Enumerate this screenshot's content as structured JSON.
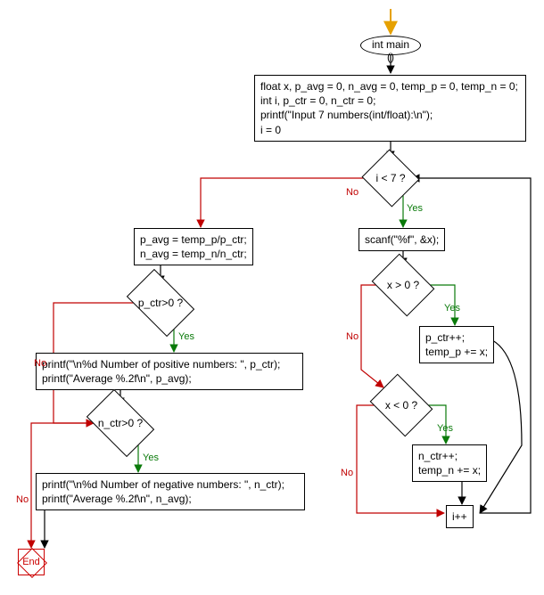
{
  "chart_data": {
    "type": "flowchart",
    "nodes": [
      {
        "id": "start",
        "label": "int main ()",
        "shape": "ellipse"
      },
      {
        "id": "init",
        "label": "float x, p_avg = 0, n_avg = 0, temp_p = 0, temp_n = 0;\nint i, p_ctr = 0, n_ctr = 0;\nprintf(\"Input 7 numbers(int/float):\\n\");\ni = 0",
        "shape": "rect"
      },
      {
        "id": "cond_i",
        "label": "i < 7 ?",
        "shape": "diamond"
      },
      {
        "id": "scan",
        "label": "scanf(\"%f\", &x);",
        "shape": "rect"
      },
      {
        "id": "cond_xpos",
        "label": "x > 0 ?",
        "shape": "diamond"
      },
      {
        "id": "pos_block",
        "label": "p_ctr++;\ntemp_p += x;",
        "shape": "rect"
      },
      {
        "id": "cond_xneg",
        "label": "x < 0 ?",
        "shape": "diamond"
      },
      {
        "id": "neg_block",
        "label": "n_ctr++;\ntemp_n += x;",
        "shape": "rect"
      },
      {
        "id": "inc",
        "label": "i++",
        "shape": "rect"
      },
      {
        "id": "calc_avg",
        "label": "p_avg = temp_p/p_ctr;\nn_avg = temp_n/n_ctr;",
        "shape": "rect"
      },
      {
        "id": "cond_pctr",
        "label": "p_ctr>0 ?",
        "shape": "diamond"
      },
      {
        "id": "print_pos",
        "label": "printf(\"\\n%d Number of positive numbers: \", p_ctr);\nprintf(\"Average %.2f\\n\", p_avg);",
        "shape": "rect"
      },
      {
        "id": "cond_nctr",
        "label": "n_ctr>0 ?",
        "shape": "diamond"
      },
      {
        "id": "print_neg",
        "label": "printf(\"\\n%d Number of negative numbers: \", n_ctr);\nprintf(\"Average %.2f\\n\", n_avg);",
        "shape": "rect"
      },
      {
        "id": "end",
        "label": "End",
        "shape": "terminator"
      }
    ],
    "edges": [
      {
        "from": "start",
        "to": "init"
      },
      {
        "from": "init",
        "to": "cond_i"
      },
      {
        "from": "cond_i",
        "to": "scan",
        "label": "Yes"
      },
      {
        "from": "cond_i",
        "to": "calc_avg",
        "label": "No"
      },
      {
        "from": "scan",
        "to": "cond_xpos"
      },
      {
        "from": "cond_xpos",
        "to": "pos_block",
        "label": "Yes"
      },
      {
        "from": "cond_xpos",
        "to": "cond_xneg",
        "label": "No"
      },
      {
        "from": "pos_block",
        "to": "inc"
      },
      {
        "from": "cond_xneg",
        "to": "neg_block",
        "label": "Yes"
      },
      {
        "from": "cond_xneg",
        "to": "inc",
        "label": "No"
      },
      {
        "from": "neg_block",
        "to": "inc"
      },
      {
        "from": "inc",
        "to": "cond_i"
      },
      {
        "from": "calc_avg",
        "to": "cond_pctr"
      },
      {
        "from": "cond_pctr",
        "to": "print_pos",
        "label": "Yes"
      },
      {
        "from": "cond_pctr",
        "to": "cond_nctr",
        "label": "No"
      },
      {
        "from": "print_pos",
        "to": "cond_nctr"
      },
      {
        "from": "cond_nctr",
        "to": "print_neg",
        "label": "Yes"
      },
      {
        "from": "cond_nctr",
        "to": "end",
        "label": "No"
      },
      {
        "from": "print_neg",
        "to": "end"
      }
    ]
  },
  "labels": {
    "yes": "Yes",
    "no": "No"
  }
}
